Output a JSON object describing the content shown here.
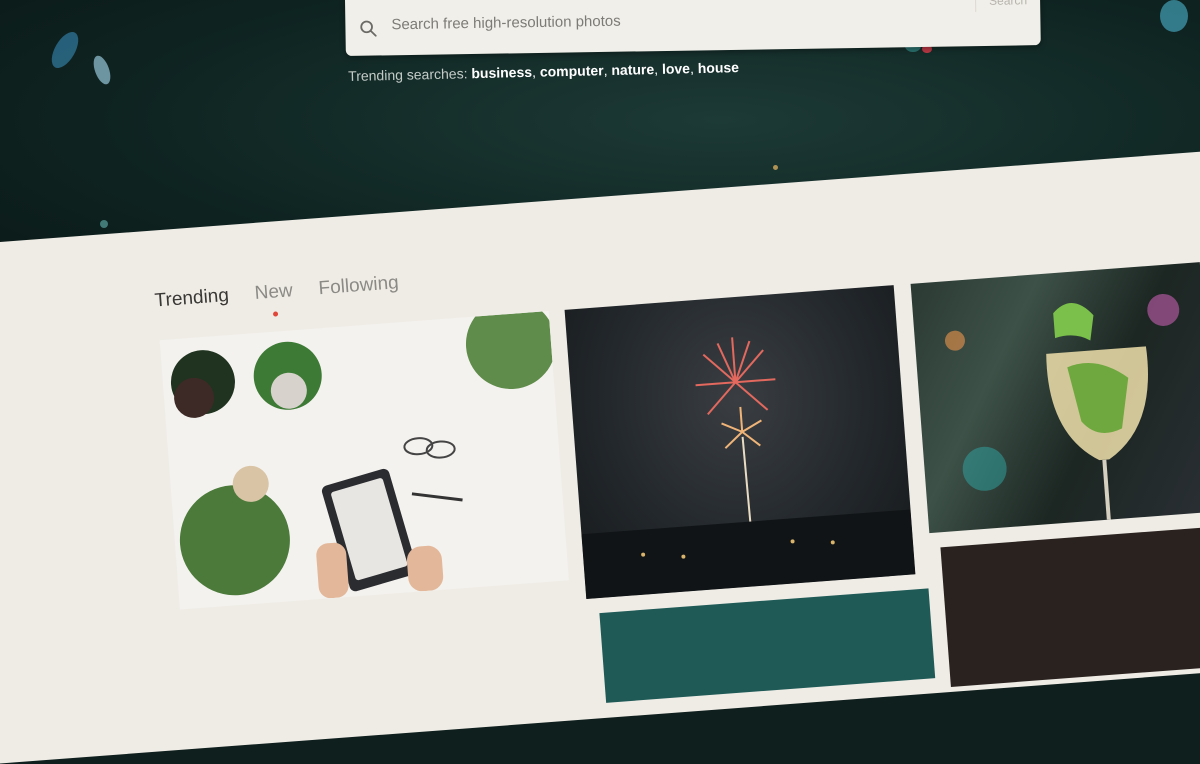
{
  "search": {
    "placeholder": "Search free high-resolution photos",
    "button_label": "Search"
  },
  "trending_searches": {
    "label": "Trending searches:",
    "items": [
      "business",
      "computer",
      "nature",
      "love",
      "house"
    ]
  },
  "tabs": [
    {
      "label": "Trending",
      "active": true
    },
    {
      "label": "New",
      "active": false
    },
    {
      "label": "Following",
      "active": false
    }
  ],
  "icons": {
    "search": "search-icon"
  },
  "colors": {
    "hero_bg": "#0f2522",
    "accent_dot": "#e0473a",
    "content_bg": "#efece6"
  }
}
